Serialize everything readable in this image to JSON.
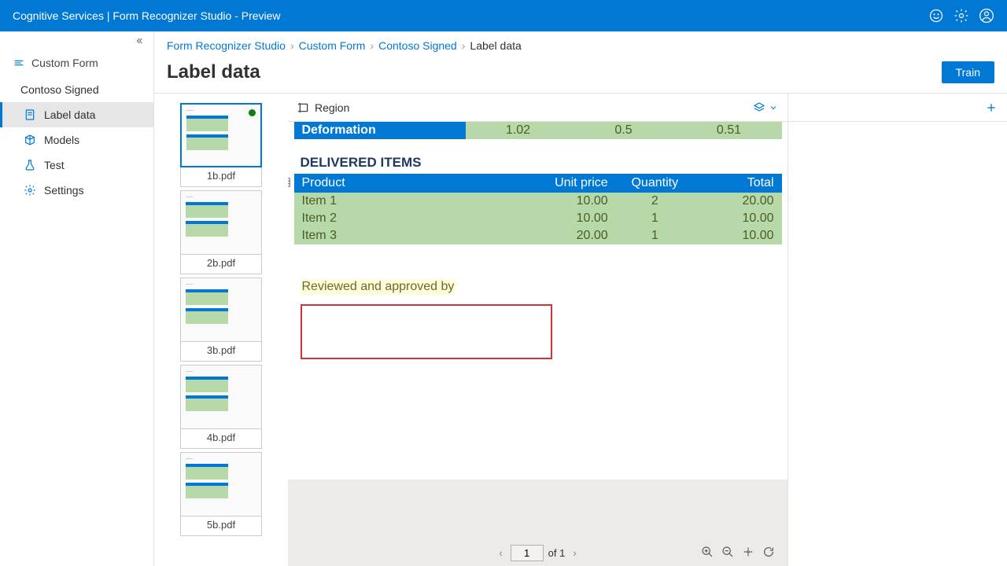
{
  "topbar": {
    "title": "Cognitive Services | Form Recognizer Studio - Preview"
  },
  "sidebar": {
    "customFormLabel": "Custom Form",
    "project": "Contoso Signed",
    "items": [
      {
        "label": "Label data"
      },
      {
        "label": "Models"
      },
      {
        "label": "Test"
      },
      {
        "label": "Settings"
      }
    ]
  },
  "breadcrumb": {
    "c0": "Form Recognizer Studio",
    "c1": "Custom Form",
    "c2": "Contoso Signed",
    "c3": "Label data"
  },
  "pageTitle": "Label data",
  "trainLabel": "Train",
  "thumbs": [
    {
      "name": "1b.pdf"
    },
    {
      "name": "2b.pdf"
    },
    {
      "name": "3b.pdf"
    },
    {
      "name": "4b.pdf"
    },
    {
      "name": "5b.pdf"
    }
  ],
  "toolbar": {
    "regionLabel": "Region"
  },
  "doc": {
    "partialHeader": "Deformation",
    "partialCells": [
      "1.02",
      "0.5",
      "0.51"
    ],
    "deliveredTitle": "DELIVERED ITEMS",
    "headers": {
      "product": "Product",
      "unitPrice": "Unit price",
      "quantity": "Quantity",
      "total": "Total"
    },
    "rows": [
      {
        "product": "Item 1",
        "unitPrice": "10.00",
        "quantity": "2",
        "total": "20.00"
      },
      {
        "product": "Item 2",
        "unitPrice": "10.00",
        "quantity": "1",
        "total": "10.00"
      },
      {
        "product": "Item 3",
        "unitPrice": "20.00",
        "quantity": "1",
        "total": "10.00"
      }
    ],
    "reviewLabel": "Reviewed and approved by"
  },
  "pager": {
    "page": "1",
    "of": "of 1"
  }
}
